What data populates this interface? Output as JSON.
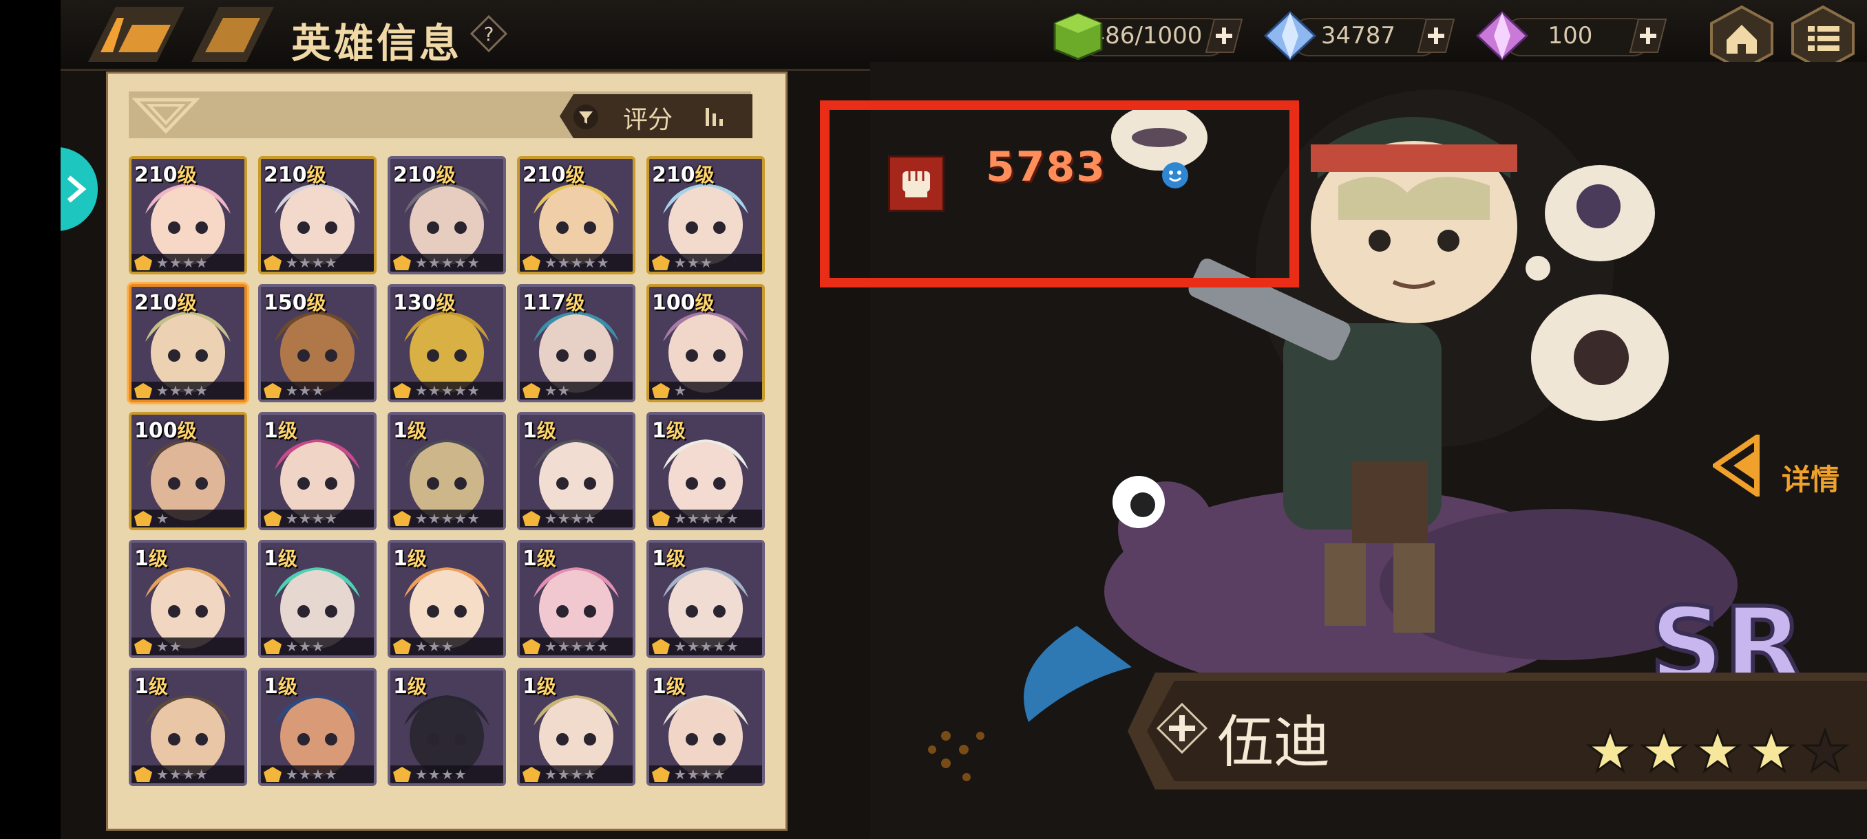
{
  "header": {
    "title": "英雄信息",
    "help_icon": "question-icon",
    "resources": [
      {
        "name": "stamina",
        "icon": "green-cube-icon",
        "value": "486/1000"
      },
      {
        "name": "diamond",
        "icon": "blue-crystal-icon",
        "value": "34787"
      },
      {
        "name": "purple-crystal",
        "icon": "pink-crystal-icon",
        "value": "100"
      }
    ],
    "home_icon": "home-icon",
    "menu_icon": "menu-icon"
  },
  "panel": {
    "sort_label": "评分"
  },
  "heroes": [
    {
      "level": "210",
      "unit": "级",
      "stars": "★★★★",
      "frame": "gold",
      "hair": "#f0b6c6",
      "skin": "#f7d8c6"
    },
    {
      "level": "210",
      "unit": "级",
      "stars": "★★★★",
      "frame": "gold",
      "hair": "#d6d3dc",
      "skin": "#f3d9cc"
    },
    {
      "level": "210",
      "unit": "级",
      "stars": "★★★★★",
      "frame": "purple",
      "hair": "#6f6a73",
      "skin": "#e6cdbf"
    },
    {
      "level": "210",
      "unit": "级",
      "stars": "★★★★★",
      "frame": "gold",
      "hair": "#e8c35a",
      "skin": "#f0cfa8"
    },
    {
      "level": "210",
      "unit": "级",
      "stars": "★★★",
      "frame": "gold",
      "hair": "#a7d3e8",
      "skin": "#f2dacd"
    },
    {
      "level": "210",
      "unit": "级",
      "stars": "★★★★",
      "frame": "selected",
      "hair": "#c6c08a",
      "skin": "#ecd2b2"
    },
    {
      "level": "150",
      "unit": "级",
      "stars": "★★★",
      "frame": "purple",
      "hair": "#6e4a2c",
      "skin": "#b07849"
    },
    {
      "level": "130",
      "unit": "级",
      "stars": "★★★★★",
      "frame": "purple",
      "hair": "#c79b2f",
      "skin": "#d8b044"
    },
    {
      "level": "117",
      "unit": "级",
      "stars": "★★",
      "frame": "purple",
      "hair": "#3a90a8",
      "skin": "#e7d0c6"
    },
    {
      "level": "100",
      "unit": "级",
      "stars": "★",
      "frame": "gold",
      "hair": "#a77ba6",
      "skin": "#f1d7c9"
    },
    {
      "level": "100",
      "unit": "级",
      "stars": "★",
      "frame": "gold",
      "hair": "#5a463c",
      "skin": "#e0b699"
    },
    {
      "level": "1",
      "unit": "级",
      "stars": "★★★★",
      "frame": "purple",
      "hair": "#c74a8b",
      "skin": "#f0d5c6"
    },
    {
      "level": "1",
      "unit": "级",
      "stars": "★★★★★",
      "frame": "purple",
      "hair": "#4b4a55",
      "skin": "#cdb68a"
    },
    {
      "level": "1",
      "unit": "级",
      "stars": "★★★★",
      "frame": "purple",
      "hair": "#55535c",
      "skin": "#f1ddd2"
    },
    {
      "level": "1",
      "unit": "级",
      "stars": "★★★★★",
      "frame": "purple",
      "hair": "#ecebe6",
      "skin": "#f3dbd1"
    },
    {
      "level": "1",
      "unit": "级",
      "stars": "★★",
      "frame": "purple",
      "hair": "#e0a45b",
      "skin": "#f1d6c2"
    },
    {
      "level": "1",
      "unit": "级",
      "stars": "★★★",
      "frame": "purple",
      "hair": "#4fd0b3",
      "skin": "#e6d7d0"
    },
    {
      "level": "1",
      "unit": "级",
      "stars": "★★★",
      "frame": "purple",
      "hair": "#ef9f5a",
      "skin": "#f5ddc8"
    },
    {
      "level": "1",
      "unit": "级",
      "stars": "★★★★★",
      "frame": "purple",
      "hair": "#e48fb0",
      "skin": "#f1c8d0"
    },
    {
      "level": "1",
      "unit": "级",
      "stars": "★★★★★",
      "frame": "purple",
      "hair": "#a6b3c8",
      "skin": "#f0dcd3"
    },
    {
      "level": "1",
      "unit": "级",
      "stars": "★★★★",
      "frame": "purple",
      "hair": "#5b4a3b",
      "skin": "#e9c6a6"
    },
    {
      "level": "1",
      "unit": "级",
      "stars": "★★★★",
      "frame": "purple",
      "hair": "#2d4a80",
      "skin": "#d99a78"
    },
    {
      "level": "1",
      "unit": "级",
      "stars": "★★★★",
      "frame": "purple",
      "hair": "#282630",
      "skin": "#2b2833"
    },
    {
      "level": "1",
      "unit": "级",
      "stars": "★★★★",
      "frame": "purple",
      "hair": "#c6b47a",
      "skin": "#f1dbcc"
    },
    {
      "level": "1",
      "unit": "级",
      "stars": "★★★★",
      "frame": "purple",
      "hair": "#e7e1d8",
      "skin": "#f1d5c6"
    }
  ],
  "showcase": {
    "power": "5783",
    "power_icon": "fist-icon",
    "detail_label": "详情",
    "rarity": "SR",
    "hero_name": "伍迪",
    "stars_filled": 4,
    "stars_total": 5
  },
  "colors": {
    "accent": "#f0a12b",
    "highlight": "#ea2d16",
    "power_text": "#ff8e5a"
  }
}
